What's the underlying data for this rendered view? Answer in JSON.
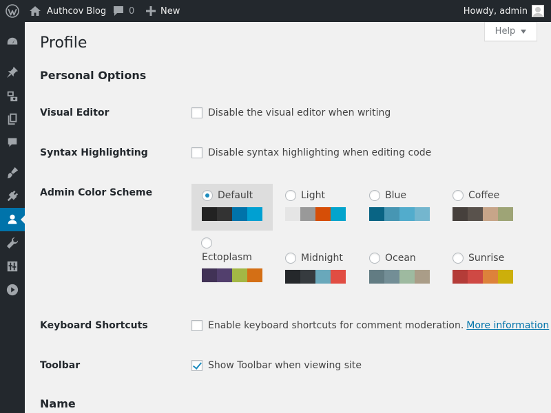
{
  "adminbar": {
    "site_name": "Authcov Blog",
    "comments_count": "0",
    "new_label": "New",
    "howdy": "Howdy, admin"
  },
  "help": {
    "label": "Help"
  },
  "page": {
    "title": "Profile",
    "personal_options": "Personal Options",
    "name_section": "Name"
  },
  "visual_editor": {
    "label": "Visual Editor",
    "option": "Disable the visual editor when writing",
    "checked": false
  },
  "syntax_highlighting": {
    "label": "Syntax Highlighting",
    "option": "Disable syntax highlighting when editing code",
    "checked": false
  },
  "color_scheme": {
    "label": "Admin Color Scheme",
    "schemes": [
      {
        "name": "Default",
        "selected": true,
        "colors": [
          "#222222",
          "#333333",
          "#0073aa",
          "#00a0d2"
        ]
      },
      {
        "name": "Light",
        "selected": false,
        "colors": [
          "#e5e5e5",
          "#999999",
          "#d64e07",
          "#04a4cc"
        ]
      },
      {
        "name": "Blue",
        "selected": false,
        "colors": [
          "#096484",
          "#4796b3",
          "#52accc",
          "#74b6ce"
        ]
      },
      {
        "name": "Coffee",
        "selected": false,
        "colors": [
          "#46403c",
          "#59524c",
          "#c7a589",
          "#9ea476"
        ]
      },
      {
        "name": "Ectoplasm",
        "selected": false,
        "colors": [
          "#413256",
          "#523f6d",
          "#a3b745",
          "#d46f15"
        ]
      },
      {
        "name": "Midnight",
        "selected": false,
        "colors": [
          "#25282b",
          "#363b3f",
          "#69a8bb",
          "#e14d43"
        ]
      },
      {
        "name": "Ocean",
        "selected": false,
        "colors": [
          "#627c83",
          "#738e96",
          "#9ebaa0",
          "#aa9d88"
        ]
      },
      {
        "name": "Sunrise",
        "selected": false,
        "colors": [
          "#b43c38",
          "#cf4944",
          "#dd823b",
          "#ccaf0b"
        ]
      }
    ]
  },
  "keyboard_shortcuts": {
    "label": "Keyboard Shortcuts",
    "option": "Enable keyboard shortcuts for comment moderation.",
    "link": "More information",
    "checked": false
  },
  "toolbar": {
    "label": "Toolbar",
    "option": "Show Toolbar when viewing site",
    "checked": true
  },
  "menu_icons": [
    "dashboard-icon",
    "posts-icon",
    "media-icon",
    "pages-icon",
    "comments-icon",
    "appearance-icon",
    "plugins-icon",
    "users-icon",
    "tools-icon",
    "settings-icon",
    "media-player-icon"
  ]
}
